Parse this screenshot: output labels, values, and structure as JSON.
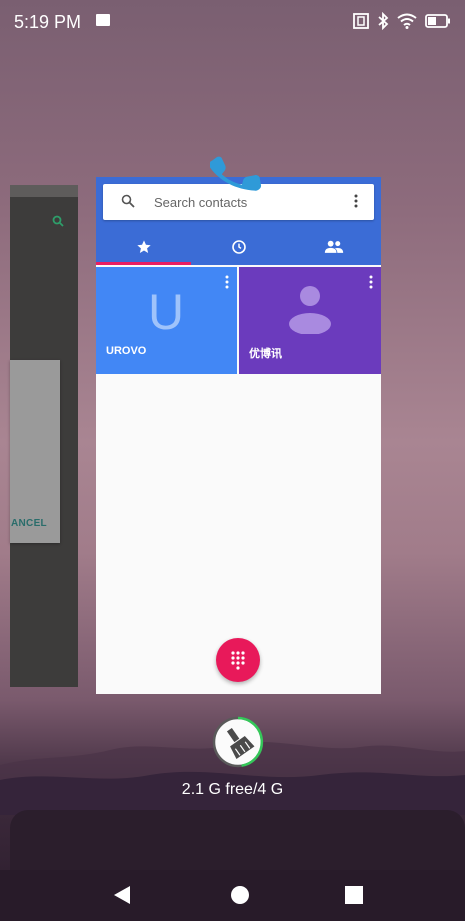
{
  "status_bar": {
    "time": "5:19 PM",
    "icons": [
      "image-notification-icon",
      "nfc-icon",
      "bluetooth-icon",
      "wifi-icon",
      "battery-icon"
    ]
  },
  "left_app": {
    "cancel_label": "ANCEL"
  },
  "contacts_app": {
    "search_placeholder": "Search contacts",
    "tabs": [
      {
        "icon": "star-icon",
        "active": true
      },
      {
        "icon": "clock-icon",
        "active": false
      },
      {
        "icon": "group-icon",
        "active": false
      }
    ],
    "favorites": [
      {
        "initial": "U",
        "name": "UROVO",
        "color": "#4287f5"
      },
      {
        "initial": "",
        "name": "优博讯",
        "color": "#6b3bbd"
      }
    ],
    "accent": "#3b6cd6",
    "fab_color": "#e8195a"
  },
  "memory": {
    "label": "2.1 G free/4 G",
    "used_fraction": 0.475
  },
  "navbar": {
    "buttons": [
      "back-icon",
      "home-icon",
      "recents-icon"
    ]
  }
}
